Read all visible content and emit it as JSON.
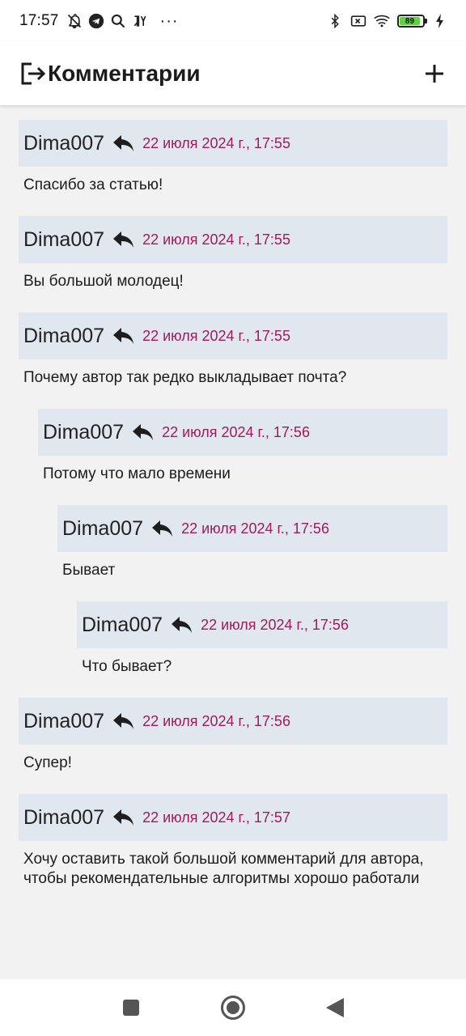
{
  "status_bar": {
    "time": "17:57",
    "battery_level": "89",
    "icons": [
      "bell-off-icon",
      "telegram-icon",
      "search-icon",
      "yandex-icon",
      "more-dots-icon",
      "bluetooth-icon",
      "no-sim-icon",
      "wifi-icon",
      "battery-icon",
      "charging-icon"
    ],
    "more": "···"
  },
  "app_bar": {
    "title": "Комментарии",
    "back_icon": "exit-arrow-icon",
    "add_icon": "plus-icon"
  },
  "comments": [
    {
      "author": "Dima007",
      "date": "22 июля 2024 г., 17:55",
      "text": "Спасибо за статью!",
      "level": 0
    },
    {
      "author": "Dima007",
      "date": "22 июля 2024 г., 17:55",
      "text": "Вы большой молодец!",
      "level": 0
    },
    {
      "author": "Dima007",
      "date": "22 июля 2024 г., 17:55",
      "text": "Почему автор так редко выкладывает почта?",
      "level": 0
    },
    {
      "author": "Dima007",
      "date": "22 июля 2024 г., 17:56",
      "text": "Потому что мало времени",
      "level": 1
    },
    {
      "author": "Dima007",
      "date": "22 июля 2024 г., 17:56",
      "text": "Бывает",
      "level": 2
    },
    {
      "author": "Dima007",
      "date": "22 июля 2024 г., 17:56",
      "text": "Что бывает?",
      "level": 3
    },
    {
      "author": "Dima007",
      "date": "22 июля 2024 г., 17:56",
      "text": "Супер!",
      "level": 0
    },
    {
      "author": "Dima007",
      "date": "22 июля 2024 г., 17:57",
      "text": "Хочу оставить такой большой комментарий для автора, чтобы рекомендательные алгоритмы хорошо работали",
      "level": 0
    }
  ],
  "colors": {
    "header_bg": "#e0e7ee",
    "date": "#a3195b",
    "page_bg": "#f2f2f2"
  },
  "nav_bar": {
    "icons": [
      "recents-square-icon",
      "home-circle-icon",
      "back-triangle-icon"
    ]
  }
}
